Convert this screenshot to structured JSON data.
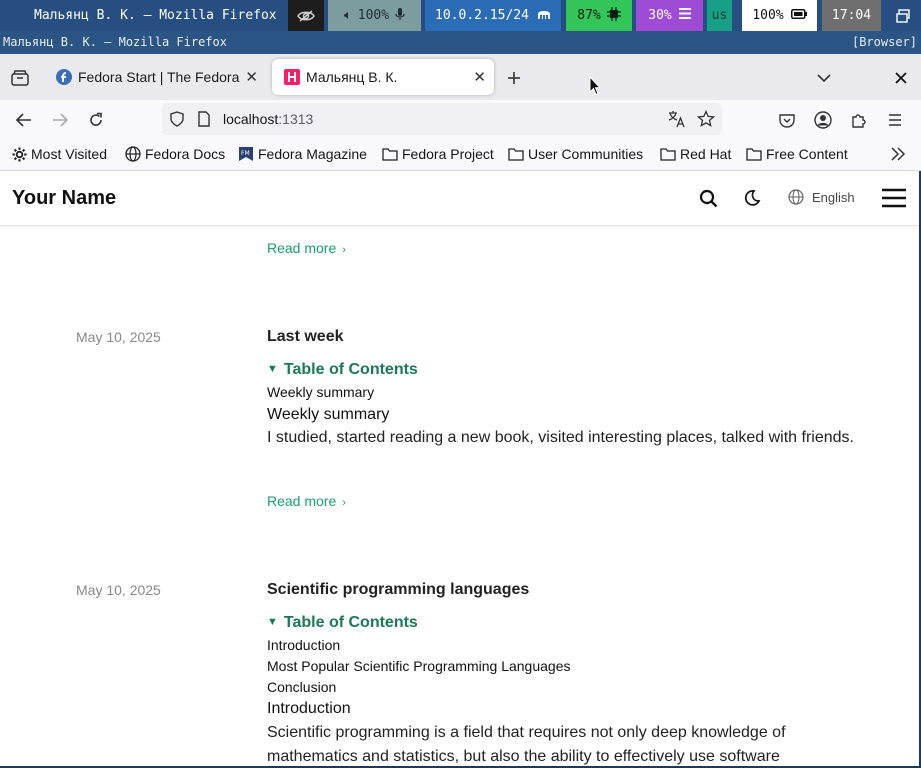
{
  "statusbar": {
    "window_title": "Мальянц В. К. — Mozilla Firefox",
    "audio": "100%",
    "network": "10.0.2.15/24",
    "cpu": "87%",
    "memory": "30%",
    "keyboard_layout": "us",
    "battery": "100%",
    "clock": "17:04"
  },
  "window": {
    "title": "Мальянц В. К. — Mozilla Firefox",
    "tag": "[Browser]"
  },
  "tabs": [
    {
      "label": "Fedora Start | The Fedora Project"
    },
    {
      "label": "Мальянц В. К."
    }
  ],
  "address": {
    "host": "localhost",
    "port": ":1313"
  },
  "bookmarks": [
    {
      "label": "Most Visited",
      "icon": "gear-icon"
    },
    {
      "label": "Fedora Docs",
      "icon": "globe-icon"
    },
    {
      "label": "Fedora Magazine",
      "icon": "fm-icon"
    },
    {
      "label": "Fedora Project",
      "icon": "folder-icon"
    },
    {
      "label": "User Communities",
      "icon": "folder-icon"
    },
    {
      "label": "Red Hat",
      "icon": "folder-icon"
    },
    {
      "label": "Free Content",
      "icon": "folder-icon"
    }
  ],
  "site": {
    "title": "Your Name",
    "language": "English"
  },
  "posts": {
    "prev_read_more": "Read more",
    "items": [
      {
        "date": "May 10, 2025",
        "title": "Last week",
        "toc_title": "Table of Contents",
        "toc": [
          "Weekly summary"
        ],
        "heading": "Weekly summary",
        "body": "I studied, started reading a new book, visited interesting places, talked with friends.",
        "read_more": "Read more"
      },
      {
        "date": "May 10, 2025",
        "title": "Scientific programming languages",
        "toc_title": "Table of Contents",
        "toc": [
          "Introduction",
          "Most Popular Scientific Programming Languages",
          "Conclusion"
        ],
        "heading": "Introduction",
        "body": "Scientific programming is a field that requires not only deep knowledge of mathematics and statistics, but also the ability to effectively use software"
      }
    ]
  },
  "colors": {
    "accent_green": "#1a9e6e",
    "toc_green": "#1a7a58",
    "statusbar_blue": "#264e80"
  }
}
